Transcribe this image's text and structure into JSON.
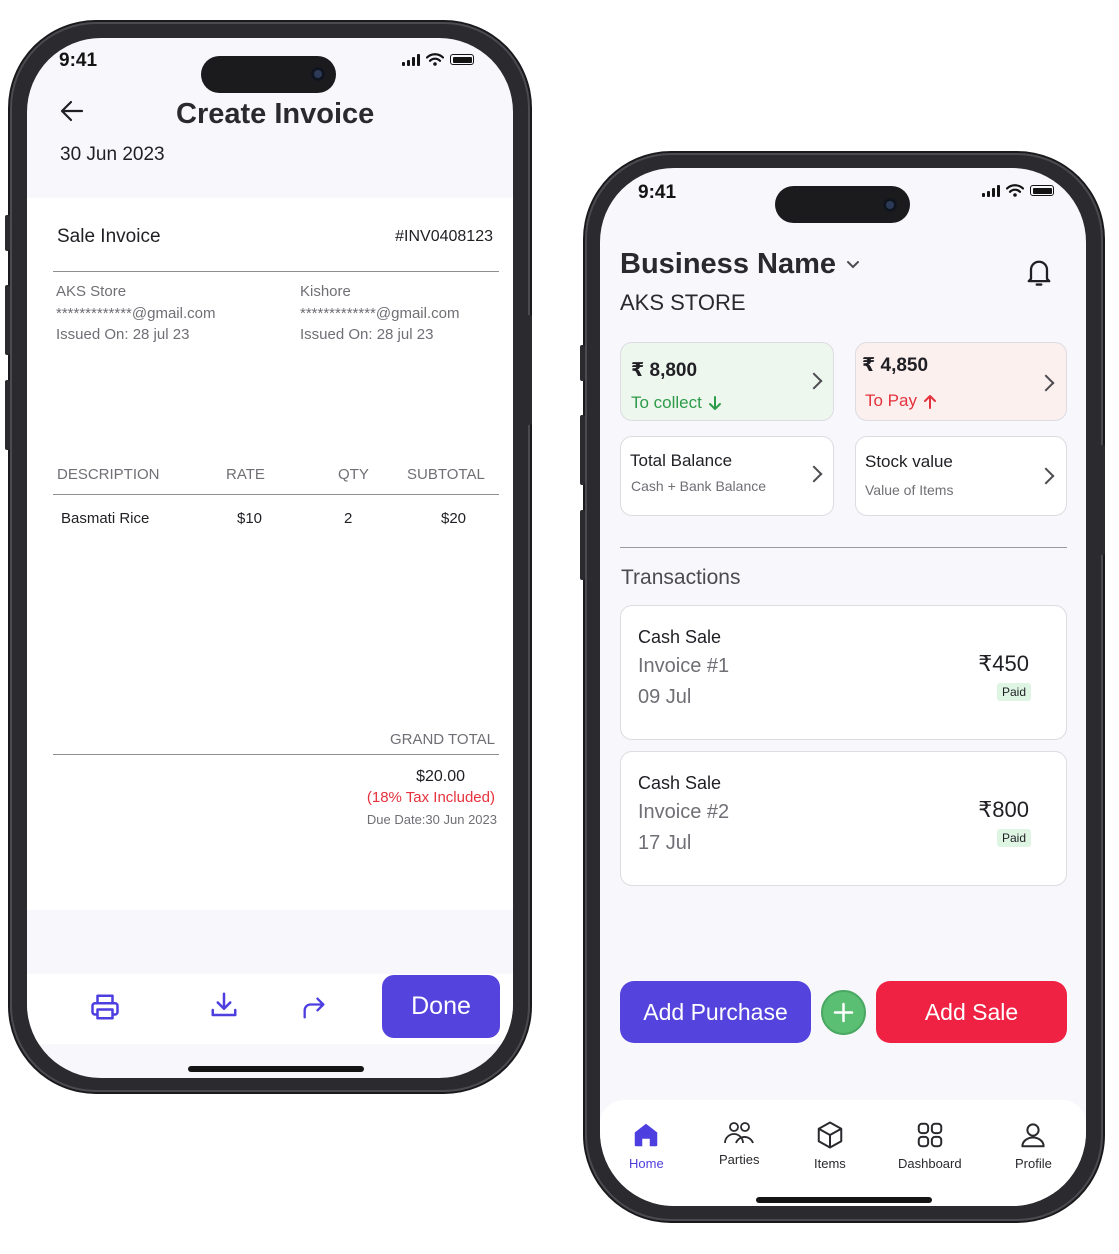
{
  "status": {
    "time": "9:41"
  },
  "invoice_screen": {
    "title": "Create Invoice",
    "date": "30 Jun 2023",
    "type": "Sale Invoice",
    "number": "#INV0408123",
    "from": {
      "name": "AKS Store",
      "email": "*************@gmail.com",
      "issued": "Issued On: 28 jul 23"
    },
    "to": {
      "name": "Kishore",
      "email": "*************@gmail.com",
      "issued": "Issued On: 28 jul 23"
    },
    "columns": [
      "DESCRIPTION",
      "RATE",
      "QTY",
      "SUBTOTAL"
    ],
    "rows": [
      {
        "description": "Basmati Rice",
        "rate": "$10",
        "qty": "2",
        "subtotal": "$20"
      }
    ],
    "grand_total_label": "GRAND TOTAL",
    "grand_total": "$20.00",
    "tax_note": "(18% Tax Included)",
    "due_date": "Due Date:30 Jun 2023",
    "done_label": "Done",
    "icons": [
      "back-arrow-icon",
      "print-icon",
      "download-icon",
      "share-icon"
    ]
  },
  "business_screen": {
    "business_name": "Business Name",
    "store_name": "AKS STORE",
    "collect": {
      "amount": "₹ 8,800",
      "label": "To collect",
      "color": "#2e9b4a"
    },
    "pay": {
      "amount": "₹ 4,850",
      "label": "To Pay",
      "color": "#e5323d"
    },
    "total_balance": {
      "title": "Total Balance",
      "subtitle": "Cash + Bank Balance"
    },
    "stock_value": {
      "title": "Stock value",
      "subtitle": "Value of Items"
    },
    "transactions_title": "Transactions",
    "transactions": [
      {
        "type": "Cash Sale",
        "invoice": "Invoice #1",
        "date": "09 Jul",
        "amount": "₹450",
        "status": "Paid"
      },
      {
        "type": "Cash Sale",
        "invoice": "Invoice #2",
        "date": "17 Jul",
        "amount": "₹800",
        "status": "Paid"
      }
    ],
    "add_purchase_label": "Add Purchase",
    "add_sale_label": "Add Sale",
    "colors": {
      "purchase": "#5443dc",
      "sale": "#ef2243",
      "plus": "#5bbf73"
    },
    "nav": [
      {
        "label": "Home",
        "icon": "home-icon",
        "active": true
      },
      {
        "label": "Parties",
        "icon": "parties-icon"
      },
      {
        "label": "Items",
        "icon": "items-box-icon"
      },
      {
        "label": "Dashboard",
        "icon": "dashboard-grid-icon"
      },
      {
        "label": "Profile",
        "icon": "profile-icon"
      }
    ]
  }
}
